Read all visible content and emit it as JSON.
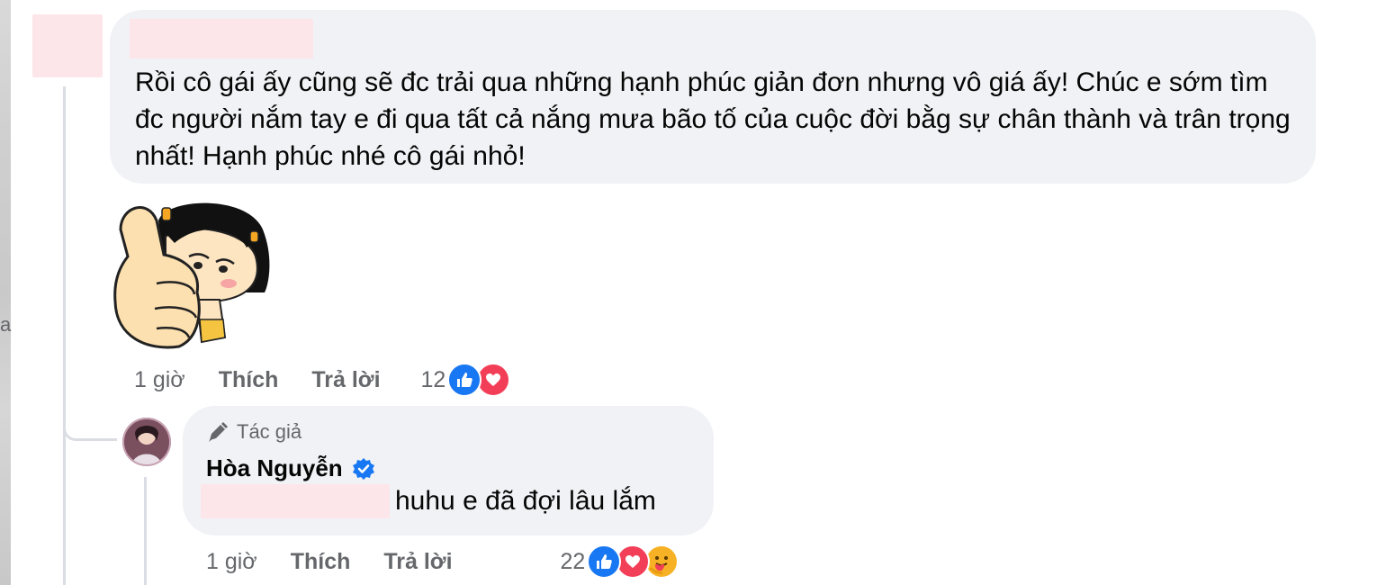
{
  "edge_char": "a",
  "comment": {
    "text": "Rồi cô gái ấy cũng sẽ đc trải qua những hạnh phúc giản đơn nhưng vô giá ấy! Chúc e sớm tìm đc người nắm tay e đi qua tất cả nắng mưa bão tố của cuộc đời bằg sự chân thành và trân trọng nhất! Hạnh phúc nhé cô gái nhỏ!",
    "sticker": "thumbs-up-girl-sticker",
    "time": "1 giờ",
    "like_label": "Thích",
    "reply_label": "Trả lời",
    "reaction_count": "12",
    "reactions": [
      "like-icon",
      "love-icon"
    ]
  },
  "reply": {
    "author_badge": "Tác giả",
    "name": "Hòa Nguyễn",
    "verified": true,
    "text": "huhu e đã đợi lâu lắm",
    "time": "1 giờ",
    "like_label": "Thích",
    "reply_label": "Trả lời",
    "reaction_count": "22",
    "reactions": [
      "like-icon",
      "love-icon",
      "care-icon"
    ]
  },
  "colors": {
    "bubble": "#f0f2f5",
    "meta_text": "#65676b",
    "like_blue": "#1877f2",
    "love_red": "#f33e58",
    "redaction": "#fde6ea"
  }
}
